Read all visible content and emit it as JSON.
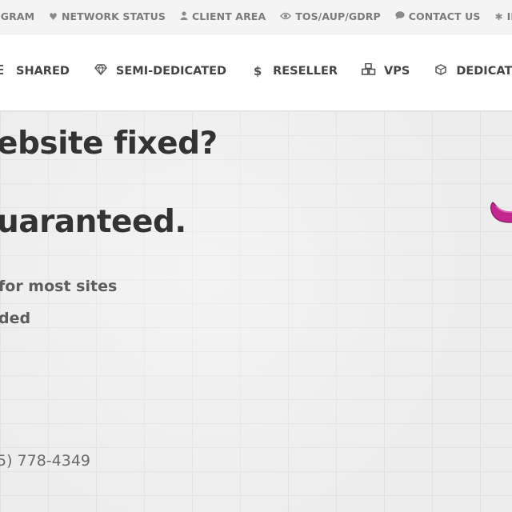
{
  "topbar": {
    "items": [
      {
        "label": "OGRAM",
        "icon": "none"
      },
      {
        "label": "NETWORK STATUS",
        "icon": "heartbeat-icon"
      },
      {
        "label": "CLIENT AREA",
        "icon": "user-icon"
      },
      {
        "label": "TOS/AUP/GDRP",
        "icon": "eye-icon"
      },
      {
        "label": "CONTACT US",
        "icon": "chat-bubble-icon"
      },
      {
        "label": "IP",
        "icon": "asterisk-icon"
      }
    ]
  },
  "mainnav": {
    "items": [
      {
        "label": "SHARED",
        "icon": "list-icon"
      },
      {
        "label": "SEMI-DEDICATED",
        "icon": "diamond-icon"
      },
      {
        "label": "RESELLER",
        "icon": "dollar-icon"
      },
      {
        "label": "VPS",
        "icon": "cubes-icon"
      },
      {
        "label": "DEDICATE",
        "icon": "cube-icon"
      }
    ]
  },
  "hero": {
    "headline_line1": "ebsite fixed?",
    "headline_line2": "uaranteed.",
    "sub_line1": "for most sites",
    "sub_line2": "ded",
    "phone": "5) 778-4349",
    "accent_color": "#c2278f"
  }
}
